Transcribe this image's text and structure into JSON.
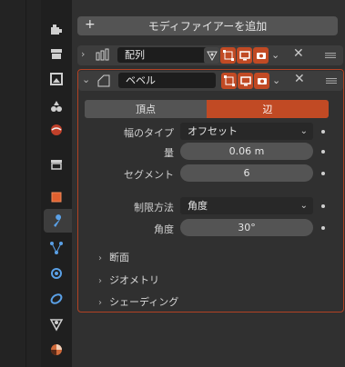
{
  "add_modifier_label": "モディファイアーを追加",
  "add_modifier_plus": "+",
  "array_modifier": {
    "name": "配列",
    "chevron": "›"
  },
  "bevel_modifier": {
    "name": "ベベル",
    "chevron": "⌄"
  },
  "close_glyph": "✕",
  "dropdown_arrow": "⌄",
  "affect": {
    "vertices_label": "頂点",
    "edges_label": "辺",
    "active": "edges"
  },
  "fields": {
    "width_type": {
      "label": "幅のタイプ",
      "value": "オフセット"
    },
    "amount": {
      "label": "量",
      "value": "0.06 m"
    },
    "segments": {
      "label": "セグメント",
      "value": "6"
    },
    "limit_method": {
      "label": "制限方法",
      "value": "角度"
    },
    "angle": {
      "label": "角度",
      "value": "30°"
    }
  },
  "subpanels": [
    {
      "label": "断面"
    },
    {
      "label": "ジオメトリ"
    },
    {
      "label": "シェーディング"
    }
  ],
  "subpanel_chevron": "›",
  "colors": {
    "accent": "#c14a24",
    "panel_border": "#b34224",
    "background": "#303030"
  },
  "icons": {
    "tabs": [
      "tool-icon",
      "render-icon",
      "output-icon",
      "view-layer-icon",
      "scene-icon",
      "world-icon",
      "collection-icon",
      "object-icon",
      "modifier-icon",
      "particles-icon",
      "physics-icon",
      "constraints-icon",
      "data-icon",
      "material-icon"
    ]
  }
}
